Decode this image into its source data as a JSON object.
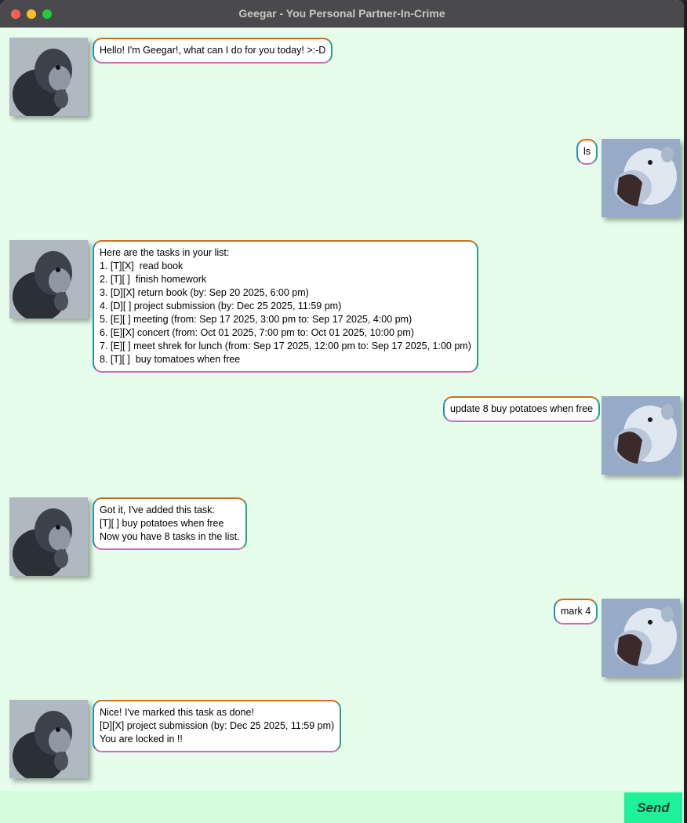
{
  "window": {
    "title": "Geegar - You Personal Partner-In-Crime"
  },
  "messages": [
    {
      "sender": "bot",
      "lines": [
        "Hello! I'm Geegar!, what can I do for you today! >:-D"
      ]
    },
    {
      "sender": "user",
      "lines": [
        "ls"
      ]
    },
    {
      "sender": "bot",
      "lines": [
        "Here are the tasks in your list:",
        "1. [T][X]  read book",
        "2. [T][ ]  finish homework",
        "3. [D][X] return book (by: Sep 20 2025, 6:00 pm)",
        "4. [D][ ] project submission (by: Dec 25 2025, 11:59 pm)",
        "5. [E][ ] meeting (from: Sep 17 2025, 3:00 pm to: Sep 17 2025, 4:00 pm)",
        "6. [E][X] concert (from: Oct 01 2025, 7:00 pm to: Oct 01 2025, 10:00 pm)",
        "7. [E][ ] meet shrek for lunch (from: Sep 17 2025, 12:00 pm to: Sep 17 2025, 1:00 pm)",
        "8. [T][ ]  buy tomatoes when free"
      ]
    },
    {
      "sender": "user",
      "lines": [
        "update 8 buy potatoes when free"
      ]
    },
    {
      "sender": "bot",
      "lines": [
        "Got it, I've added this task:",
        "[T][ ] buy potatoes when free",
        "Now you have 8 tasks in the list."
      ]
    },
    {
      "sender": "user",
      "lines": [
        "mark 4"
      ]
    },
    {
      "sender": "bot",
      "lines": [
        "Nice! I've marked this task as done!",
        "[D][X] project submission (by: Dec 25 2025, 11:59 pm)",
        "You are locked in !!"
      ]
    }
  ],
  "input": {
    "value": "",
    "placeholder": ""
  },
  "send_label": "Send",
  "colors": {
    "chat_background": "#e6fdeb",
    "input_background": "#d6fce0",
    "send_button": "#1ef19a",
    "bubble_border_top": "#cf6d1e",
    "bubble_border_right": "#2a9e8a",
    "bubble_border_bottom": "#c86fb2"
  },
  "icons": {
    "bot_avatar": "chimpanzee-avatar-icon",
    "user_avatar": "roaring-lion-avatar-icon"
  }
}
